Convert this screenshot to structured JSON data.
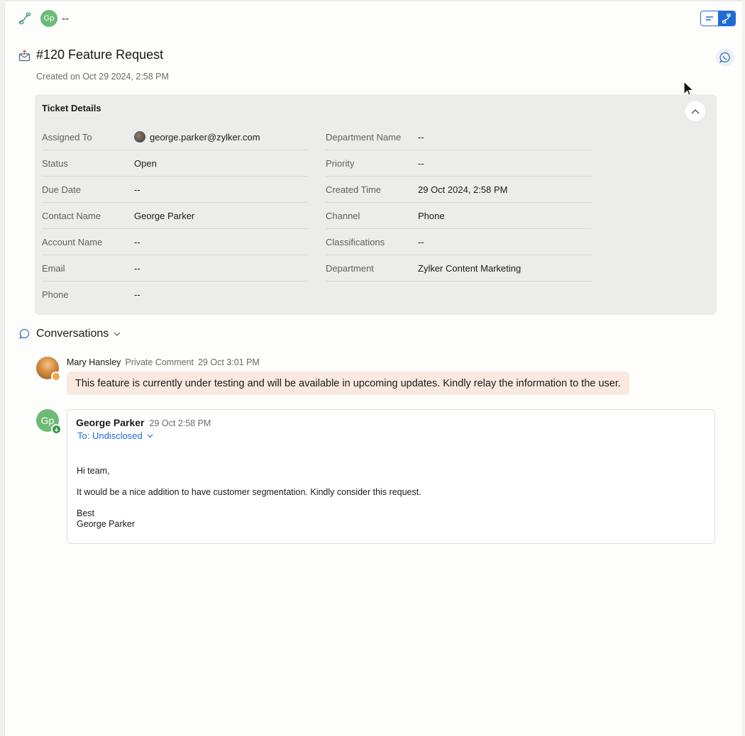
{
  "topbar": {
    "avatar_initials": "Gp",
    "assignee_placeholder": "--"
  },
  "ticket": {
    "title": "#120 Feature Request",
    "created_on": "Created on Oct 29 2024, 2:58 PM"
  },
  "details": {
    "heading": "Ticket Details",
    "left": [
      {
        "label": "Assigned To",
        "value": "george.parker@zylker.com"
      },
      {
        "label": "Status",
        "value": "Open"
      },
      {
        "label": "Due Date",
        "value": "--"
      },
      {
        "label": "Contact Name",
        "value": "George Parker"
      },
      {
        "label": "Account Name",
        "value": "--"
      },
      {
        "label": "Email",
        "value": "--"
      },
      {
        "label": "Phone",
        "value": "--"
      }
    ],
    "right": [
      {
        "label": "Department Name",
        "value": "--"
      },
      {
        "label": "Priority",
        "value": "--"
      },
      {
        "label": "Created Time",
        "value": "29 Oct 2024, 2:58 PM"
      },
      {
        "label": "Channel",
        "value": "Phone"
      },
      {
        "label": "Classifications",
        "value": "--"
      },
      {
        "label": "Department",
        "value": "Zylker Content Marketing"
      }
    ]
  },
  "conversations": {
    "heading": "Conversations",
    "comment": {
      "author": "Mary Hansley",
      "type": "Private Comment",
      "time": "29 Oct 3:01 PM",
      "text": "This feature is currently under testing and will be available in upcoming updates. Kindly relay the information to the user."
    },
    "email": {
      "avatar_initials": "Gp",
      "sender": "George Parker",
      "time": "29 Oct 2:58 PM",
      "to": "To: Undisclosed",
      "greeting": "Hi team,",
      "body": "It would be a nice addition to have customer segmentation. Kindly consider this request.",
      "signoff": "Best",
      "signature": "George Parker"
    }
  },
  "colors": {
    "accent": "#1f6bd1",
    "avatar_green": "#6dbb74",
    "private_comment_bg": "#fae9df",
    "details_panel_bg": "#ececeb"
  }
}
